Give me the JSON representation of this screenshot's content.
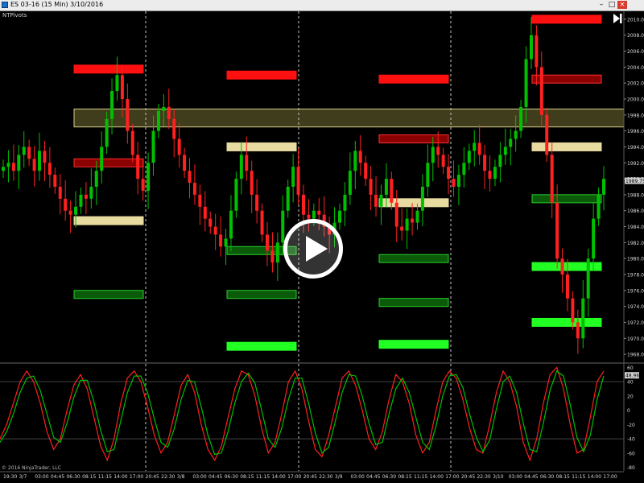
{
  "window": {
    "title": "ES 03-16 (15 Min)  3/10/2016",
    "minimize_label": "–",
    "maximize_label": "□",
    "close_label": "×"
  },
  "indicator_label": "NTPivots",
  "copyright": "© 2016 NinjaTrader, LLC",
  "price_axis": {
    "ticks": [
      "2010.00",
      "2008.00",
      "2006.00",
      "2004.00",
      "2002.00",
      "2000.00",
      "1998.00",
      "1996.00",
      "1994.00",
      "1992.00",
      "1990.00",
      "1988.00",
      "1986.00",
      "1984.00",
      "1982.00",
      "1980.00",
      "1978.00",
      "1976.00",
      "1974.00",
      "1972.00",
      "1970.00",
      "1968.00"
    ],
    "last_price": "1989.75"
  },
  "oscillator_axis": {
    "ticks": [
      "60",
      "40",
      "20",
      "0",
      "-20",
      "-40",
      "-60",
      "-80"
    ],
    "last_value": "48.96"
  },
  "time_axis": {
    "labels": [
      "19:30",
      "3/7",
      "03:00",
      "04:45",
      "06:30",
      "08:15",
      "11:15",
      "14:00",
      "17:00",
      "20:45",
      "22:30",
      "3/8",
      "03:00",
      "04:45",
      "06:30",
      "08:15",
      "11:15",
      "14:00",
      "17:00",
      "20:45",
      "22:30",
      "3/9",
      "03:00",
      "04:45",
      "06:30",
      "08:15",
      "11:15",
      "14:00",
      "17:00",
      "20:45",
      "22:30",
      "3/10",
      "03:00",
      "04:45",
      "06:30",
      "08:15",
      "11:15",
      "14:00",
      "17:00"
    ]
  },
  "colors": {
    "background": "#000000",
    "candle_up": "#00c000",
    "candle_down": "#ff2020",
    "resistance_strong": "#ff1010",
    "resistance_weak": "#8b0000",
    "pivot": "#e8dba0",
    "support_weak": "#0a5a0a",
    "support_strong": "#22ff22",
    "session_divider": "#c8c8c8",
    "stoch_k": "#ff2020",
    "stoch_d": "#00c000"
  },
  "chart_data": [
    {
      "type": "candlestick",
      "instrument": "ES 03-16",
      "interval": "15 Min",
      "ylim": [
        1967,
        2011
      ],
      "sessions": [
        {
          "date": "3/7",
          "R2": 2003.75,
          "R1": 1992.0,
          "PP": 1984.75,
          "S1": 1975.5,
          "R3": null,
          "S2": null,
          "S3": null
        },
        {
          "date": "3/8",
          "R3": 2003.0,
          "PP": 1994.0,
          "S1": 1981.0,
          "S2": 1975.5,
          "S3": 1969.0
        },
        {
          "date": "3/9",
          "R3": 2002.5,
          "R2": 1995.0,
          "PP": 1987.0,
          "S1": 1980.0,
          "S2": 1974.5,
          "S3": 1969.25
        },
        {
          "date": "3/10",
          "R3": 2010.0,
          "R2": 2002.5,
          "PP": 1994.0,
          "S1": 1987.5,
          "S2": 1979.0,
          "S3": 1972.0
        }
      ],
      "zone": {
        "from": 1996.5,
        "to": 1998.75
      },
      "close_series": [
        1991.5,
        1992.0,
        1991.0,
        1993.0,
        1994.0,
        1992.5,
        1991.0,
        1993.5,
        1992.0,
        1990.5,
        1989.0,
        1987.5,
        1986.0,
        1985.5,
        1986.5,
        1988.0,
        1987.5,
        1989.0,
        1991.0,
        1994.0,
        1997.5,
        2001.0,
        2003.0,
        2000.0,
        1996.0,
        1993.0,
        1990.0,
        1988.5,
        1992.0,
        1996.0,
        1998.5,
        1999.0,
        1997.5,
        1995.0,
        1993.0,
        1991.0,
        1989.5,
        1988.0,
        1986.5,
        1985.0,
        1984.0,
        1983.0,
        1981.5,
        1982.5,
        1986.0,
        1990.0,
        1993.0,
        1991.0,
        1988.0,
        1986.0,
        1983.0,
        1981.0,
        1979.5,
        1982.0,
        1986.0,
        1989.0,
        1991.5,
        1988.0,
        1985.5,
        1985.0,
        1986.0,
        1985.5,
        1984.0,
        1983.0,
        1984.5,
        1986.0,
        1988.0,
        1991.0,
        1993.5,
        1992.0,
        1990.0,
        1988.0,
        1986.5,
        1988.0,
        1990.0,
        1987.0,
        1984.0,
        1983.5,
        1985.0,
        1984.5,
        1986.0,
        1989.0,
        1992.0,
        1994.0,
        1993.0,
        1991.5,
        1990.0,
        1989.0,
        1990.5,
        1992.0,
        1993.5,
        1994.5,
        1993.0,
        1991.0,
        1990.0,
        1991.5,
        1993.0,
        1994.0,
        1995.0,
        1996.0,
        1999.0,
        2005.0,
        2008.0,
        2004.0,
        1998.0,
        1993.0,
        1987.0,
        1980.0,
        1978.0,
        1975.0,
        1972.0,
        1970.0,
        1975.0,
        1980.0,
        1985.0,
        1988.0,
        1990.0
      ]
    },
    {
      "type": "line",
      "name": "Stochastics",
      "ylim": [
        -85,
        65
      ],
      "series": [
        {
          "name": "K",
          "values": [
            -40,
            -20,
            10,
            40,
            55,
            40,
            10,
            -30,
            -55,
            -40,
            0,
            35,
            50,
            30,
            -10,
            -50,
            -70,
            -40,
            10,
            45,
            55,
            40,
            5,
            -35,
            -60,
            -45,
            -5,
            35,
            50,
            25,
            -20,
            -55,
            -70,
            -50,
            -10,
            30,
            55,
            50,
            20,
            -25,
            -60,
            -45,
            -5,
            40,
            55,
            30,
            -15,
            -55,
            -65,
            -35,
            5,
            45,
            55,
            35,
            0,
            -40,
            -55,
            -30,
            15,
            50,
            40,
            10,
            -35,
            -60,
            -45,
            0,
            40,
            55,
            45,
            15,
            -25,
            -55,
            -60,
            -20,
            25,
            55,
            40,
            5,
            -45,
            -70,
            -40,
            10,
            50,
            60,
            30,
            -20,
            -60,
            -55,
            -10,
            40,
            55
          ]
        },
        {
          "name": "D",
          "values": [
            -45,
            -30,
            -5,
            25,
            45,
            48,
            28,
            -5,
            -38,
            -45,
            -18,
            18,
            42,
            42,
            12,
            -28,
            -58,
            -55,
            -15,
            25,
            48,
            48,
            25,
            -12,
            -45,
            -52,
            -25,
            15,
            42,
            40,
            5,
            -35,
            -62,
            -60,
            -30,
            10,
            40,
            52,
            38,
            0,
            -40,
            -52,
            -25,
            15,
            45,
            45,
            10,
            -32,
            -60,
            -52,
            -15,
            25,
            50,
            48,
            20,
            -18,
            -48,
            -45,
            -5,
            30,
            45,
            25,
            -10,
            -45,
            -55,
            -22,
            20,
            48,
            50,
            32,
            -5,
            -38,
            -58,
            -42,
            2,
            40,
            48,
            25,
            -18,
            -55,
            -58,
            -18,
            28,
            55,
            48,
            8,
            -38,
            -58,
            -35,
            15,
            48
          ]
        }
      ]
    }
  ]
}
